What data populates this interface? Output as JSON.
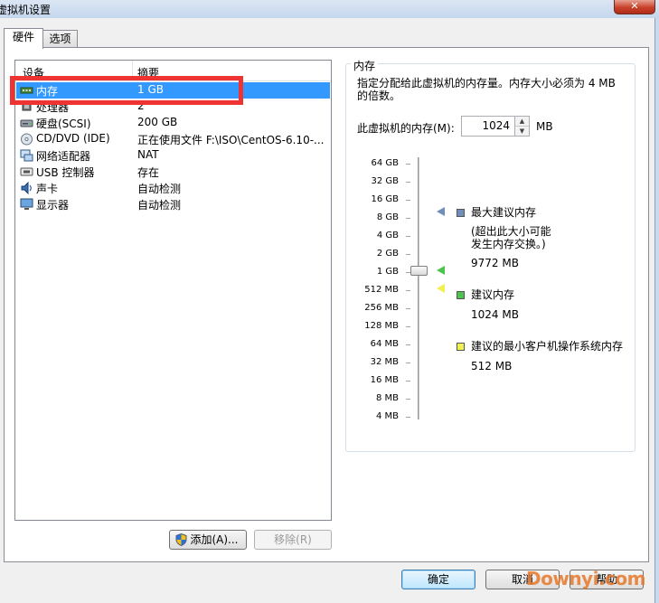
{
  "window": {
    "title": "虚拟机设置",
    "close_symbol": "✕"
  },
  "tabs": [
    {
      "label": "硬件"
    },
    {
      "label": "选项"
    }
  ],
  "device_list": {
    "columns": {
      "device": "设备",
      "summary": "摘要"
    },
    "rows": [
      {
        "name": "内存",
        "value": "1 GB",
        "icon": "memory-icon"
      },
      {
        "name": "处理器",
        "value": "2",
        "icon": "processor-icon"
      },
      {
        "name": "硬盘(SCSI)",
        "value": "200 GB",
        "icon": "harddisk-icon"
      },
      {
        "name": "CD/DVD (IDE)",
        "value": "正在使用文件 F:\\ISO\\CentOS-6.10-...",
        "icon": "cd-dvd-icon"
      },
      {
        "name": "网络适配器",
        "value": "NAT",
        "icon": "network-adapter-icon"
      },
      {
        "name": "USB 控制器",
        "value": "存在",
        "icon": "usb-icon"
      },
      {
        "name": "声卡",
        "value": "自动检测",
        "icon": "sound-card-icon"
      },
      {
        "name": "显示器",
        "value": "自动检测",
        "icon": "display-icon"
      }
    ],
    "selected_index": 0
  },
  "buttons": {
    "add": "添加(A)...",
    "remove": "移除(R)",
    "ok": "确定",
    "cancel": "取消",
    "help": "帮助"
  },
  "memory": {
    "group_title": "内存",
    "description": "指定分配给此虚拟机的内存量。内存大小必须为 4 MB 的倍数。",
    "field_label": "此虚拟机的内存(M):",
    "value": "1024",
    "unit": "MB",
    "scale_labels": [
      "64 GB",
      "32 GB",
      "16 GB",
      "8 GB",
      "4 GB",
      "2 GB",
      "1 GB",
      "512 MB",
      "256 MB",
      "128 MB",
      "64 MB",
      "32 MB",
      "16 MB",
      "8 MB",
      "4 MB"
    ],
    "legend": {
      "max_recommended": {
        "label": "最大建议内存",
        "note_line1": "(超出此大小可能",
        "note_line2": "发生内存交换。)",
        "value": "9772 MB",
        "color": "#6f8fb8"
      },
      "recommended": {
        "label": "建议内存",
        "value": "1024 MB",
        "color": "#4dc44d"
      },
      "min_recommended": {
        "label": "建议的最小客户机操作系统内存",
        "value": "512 MB",
        "color": "#f0f050"
      }
    }
  },
  "watermark": "Downyi.com"
}
